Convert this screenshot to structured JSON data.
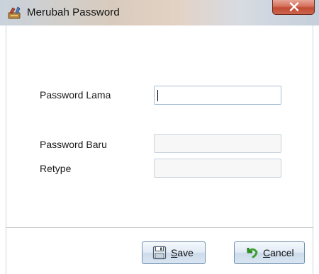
{
  "window": {
    "title": "Merubah Password",
    "icon": "tools-icon",
    "close_icon": "close-x-icon"
  },
  "form": {
    "old_password": {
      "label": "Password Lama",
      "value": ""
    },
    "new_password": {
      "label": "Password Baru",
      "value": ""
    },
    "retype": {
      "label": "Retype",
      "value": ""
    }
  },
  "buttons": {
    "save": {
      "mnemonic": "S",
      "rest": "ave",
      "icon": "floppy-disk-icon"
    },
    "cancel": {
      "mnemonic": "C",
      "rest": "ancel",
      "icon": "undo-arrow-icon"
    }
  }
}
